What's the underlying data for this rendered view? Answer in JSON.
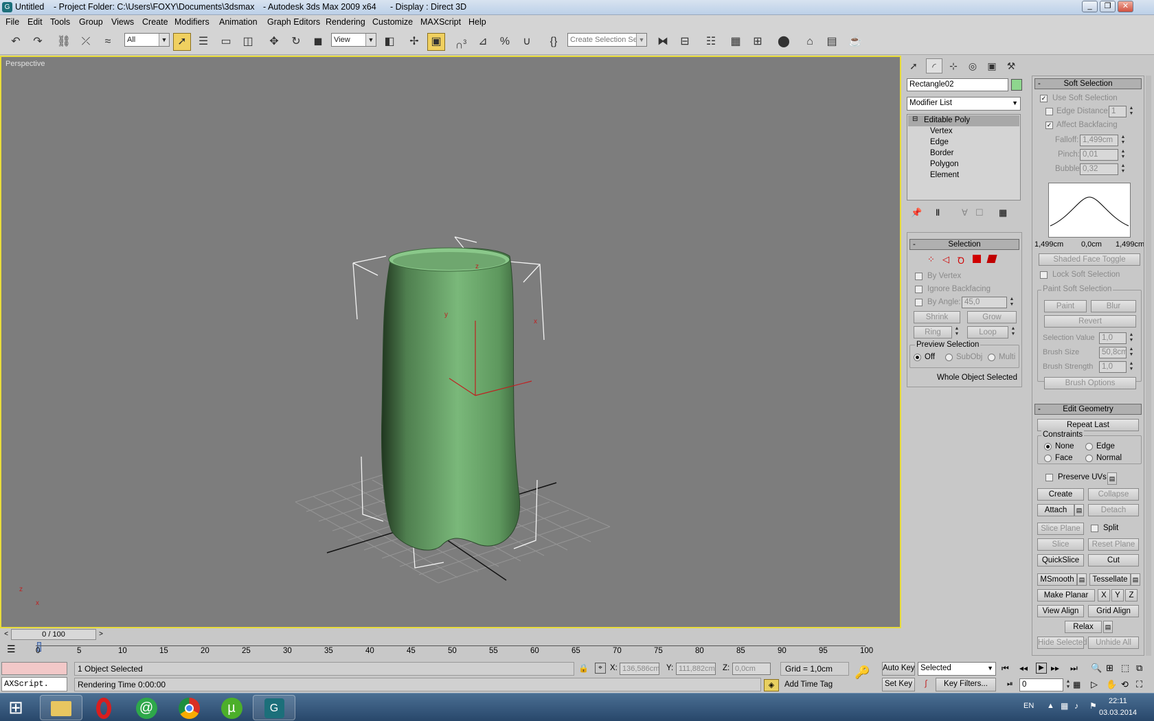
{
  "window": {
    "title_parts": [
      "Untitled",
      "- Project Folder: C:\\Users\\FOXY\\Documents\\3dsmax",
      "- Autodesk 3ds Max  2009 x64",
      "- Display : Direct 3D"
    ],
    "controls": [
      "_",
      "❐",
      "✕"
    ]
  },
  "menu": [
    "File",
    "Edit",
    "Tools",
    "Group",
    "Views",
    "Create",
    "Modifiers",
    "Animation",
    "Graph Editors",
    "Rendering",
    "Customize",
    "MAXScript",
    "Help"
  ],
  "toolbar": {
    "selection_filter": "All",
    "reference_coord": "View",
    "named_selection": "Create Selection Set",
    "snap_label": "3"
  },
  "viewport": {
    "label": "Perspective",
    "axis_labels": {
      "z": "z",
      "y": "y",
      "x": "x"
    },
    "object_color": "#6aa870"
  },
  "command_panel": {
    "object_name": "Rectangle02",
    "object_color": "#8ed68e",
    "modifier_list": "Modifier List",
    "stack": [
      "Editable Poly",
      "Vertex",
      "Edge",
      "Border",
      "Polygon",
      "Element"
    ],
    "selection": {
      "title": "Selection",
      "by_vertex": "By Vertex",
      "ignore_backfacing": "Ignore Backfacing",
      "by_angle": "By Angle:",
      "by_angle_value": "45,0",
      "shrink": "Shrink",
      "grow": "Grow",
      "ring": "Ring",
      "loop": "Loop",
      "preview_selection": "Preview Selection",
      "preview_options": [
        "Off",
        "SubObj",
        "Multi"
      ],
      "status": "Whole Object Selected"
    }
  },
  "soft_selection": {
    "title": "Soft Selection",
    "use_soft_selection": "Use Soft Selection",
    "edge_distance": "Edge Distance:",
    "edge_distance_value": "1",
    "affect_backfacing": "Affect Backfacing",
    "falloff": "Falloff:",
    "falloff_value": "1,499cm",
    "pinch": "Pinch:",
    "pinch_value": "0,01",
    "bubble": "Bubble:",
    "bubble_value": "0,32",
    "curve_labels": [
      "1,499cm",
      "0,0cm",
      "1,499cm"
    ],
    "shaded_face_toggle": "Shaded Face Toggle",
    "lock_soft_selection": "Lock Soft Selection",
    "paint_soft_selection": "Paint Soft Selection",
    "paint": "Paint",
    "blur": "Blur",
    "revert": "Revert",
    "selection_value": "Selection Value",
    "selection_value_v": "1,0",
    "brush_size": "Brush Size",
    "brush_size_v": "50,8cm",
    "brush_strength": "Brush Strength",
    "brush_strength_v": "1,0",
    "brush_options": "Brush Options"
  },
  "edit_geometry": {
    "title": "Edit Geometry",
    "repeat_last": "Repeat Last",
    "constraints": "Constraints",
    "constraint_options": [
      "None",
      "Edge",
      "Face",
      "Normal"
    ],
    "preserve_uvs": "Preserve UVs",
    "create": "Create",
    "collapse": "Collapse",
    "attach": "Attach",
    "detach": "Detach",
    "slice_plane": "Slice Plane",
    "split": "Split",
    "slice": "Slice",
    "reset_plane": "Reset Plane",
    "quickslice": "QuickSlice",
    "cut": "Cut",
    "msmooth": "MSmooth",
    "tessellate": "Tessellate",
    "make_planar": "Make Planar",
    "x": "X",
    "y": "Y",
    "z": "Z",
    "view_align": "View Align",
    "grid_align": "Grid Align",
    "relax": "Relax",
    "hide_selected": "Hide Selected",
    "unhide_all": "Unhide All"
  },
  "timeline": {
    "slider": "0 / 100",
    "ticks": [
      "0",
      "5",
      "10",
      "15",
      "20",
      "25",
      "30",
      "35",
      "40",
      "45",
      "50",
      "55",
      "60",
      "65",
      "70",
      "75",
      "80",
      "85",
      "90",
      "95",
      "100"
    ]
  },
  "status": {
    "maxscript": "AXScript.",
    "objects_selected": "1 Object Selected",
    "rendering_time": "Rendering Time  0:00:00",
    "x_label": "X:",
    "x_value": "136,586cm",
    "y_label": "Y:",
    "y_value": "111,882cm",
    "z_label": "Z:",
    "z_value": "0,0cm",
    "grid": "Grid = 1,0cm",
    "add_time_tag": "Add Time Tag",
    "auto_key": "Auto Key",
    "set_key": "Set Key",
    "key_mode": "Selected",
    "key_filters": "Key Filters...",
    "frame": "0"
  },
  "taskbar": {
    "lang": "EN",
    "time": "22:11",
    "date": "03.03.2014"
  }
}
